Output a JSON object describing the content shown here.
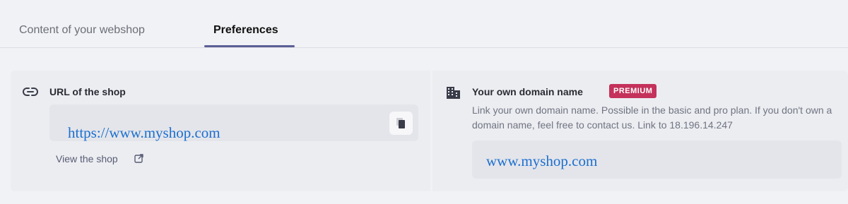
{
  "tabs": [
    {
      "label": "Content of your webshop",
      "active": false
    },
    {
      "label": "Preferences",
      "active": true
    }
  ],
  "url_section": {
    "title": "URL of the shop",
    "icon": "link-icon",
    "url_value": "https://www.myshop.com",
    "copy_icon": "copy-icon",
    "view_link": "View the shop",
    "view_icon": "external-link-icon"
  },
  "domain_section": {
    "title": "Your own domain name",
    "icon": "building-icon",
    "badge": "PREMIUM",
    "description": "Link your own domain name. Possible in the basic and pro plan. If you don't own a domain name, feel free to contact us. Link to 18.196.14.247",
    "domain_value": "www.myshop.com"
  },
  "colors": {
    "accent": "#5b5f97",
    "badge": "#c4315b",
    "link_text": "#1b6fd0"
  }
}
